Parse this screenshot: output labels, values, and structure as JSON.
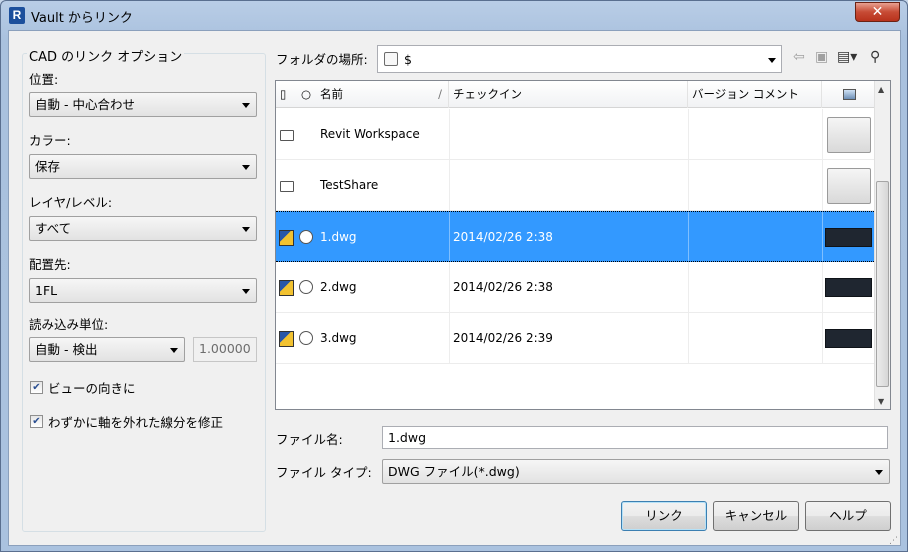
{
  "window": {
    "title": "Vault からリンク",
    "close_label": "✕"
  },
  "options": {
    "group_title": "CAD のリンク オプション",
    "position": {
      "label": "位置:",
      "value": "自動 - 中心合わせ"
    },
    "color": {
      "label": "カラー:",
      "value": "保存"
    },
    "layer": {
      "label": "レイヤ/レベル:",
      "value": "すべて"
    },
    "placement": {
      "label": "配置先:",
      "value": "1FL"
    },
    "units": {
      "label": "読み込み単位:",
      "value": "自動 - 検出",
      "scale": "1.00000"
    },
    "orient_to_view": {
      "label": "ビューの向きに",
      "checked": true
    },
    "correct_lines": {
      "label": "わずかに軸を外れた線分を修正",
      "checked": true
    }
  },
  "folder": {
    "label": "フォルダの場所:",
    "value": "$"
  },
  "toolbar": {
    "back_icon": "back-arrow-icon",
    "up_folder_icon": "up-folder-icon",
    "views_icon": "views-menu-icon",
    "find_icon": "binoculars-icon"
  },
  "grid": {
    "columns": [
      "名前",
      "チェックイン",
      "バージョン コメント"
    ],
    "sort_indicator": "/",
    "rows": [
      {
        "type": "folder",
        "name": "Revit Workspace",
        "checkin": "",
        "comment": "",
        "selected": false
      },
      {
        "type": "folder",
        "name": "TestShare",
        "checkin": "",
        "comment": "",
        "selected": false
      },
      {
        "type": "dwg",
        "name": "1.dwg",
        "checkin": "2014/02/26 2:38",
        "comment": "",
        "selected": true
      },
      {
        "type": "dwg",
        "name": "2.dwg",
        "checkin": "2014/02/26 2:38",
        "comment": "",
        "selected": false
      },
      {
        "type": "dwg",
        "name": "3.dwg",
        "checkin": "2014/02/26 2:39",
        "comment": "",
        "selected": false
      }
    ]
  },
  "filename": {
    "label": "ファイル名:",
    "value": "1.dwg"
  },
  "filetype": {
    "label": "ファイル タイプ:",
    "value": "DWG ファイル(*.dwg)"
  },
  "buttons": {
    "link": "リンク",
    "cancel": "キャンセル",
    "help": "ヘルプ"
  },
  "colors": {
    "selection": "#3399ff",
    "title_bar": "#b9cde6",
    "close": "#c74b35"
  }
}
